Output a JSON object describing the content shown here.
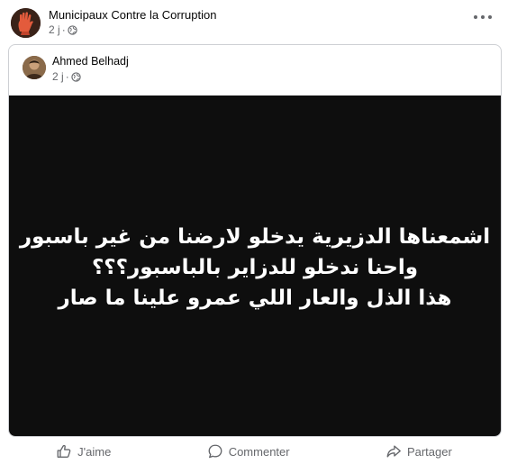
{
  "page": {
    "name": "Municipaux Contre la Corruption",
    "time": "2 j"
  },
  "shared_post": {
    "author": "Ahmed Belhadj",
    "time": "2 j",
    "image_text": [
      "اشمعناها الدزيرية يدخلو لارضنا من غير باسبور",
      "واحنا ندخلو للدزاير بالباسبور؟؟؟",
      "هذا الذل والعار اللي عمرو علينا ما صار"
    ],
    "image_background": "#0e0e0e"
  },
  "actions": {
    "like": "J'aime",
    "comment": "Commenter",
    "share": "Partager"
  },
  "icons": [
    "more-options-icon",
    "globe-icon",
    "like-icon",
    "comment-icon",
    "share-icon"
  ]
}
